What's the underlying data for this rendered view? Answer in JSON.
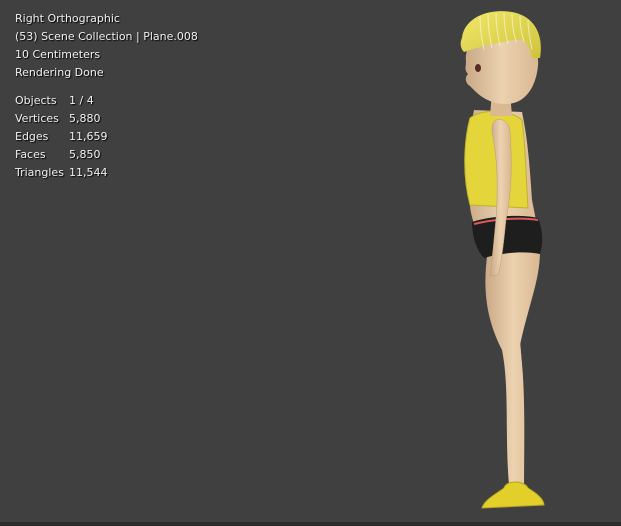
{
  "viewport": {
    "view_name": "Right Orthographic",
    "collection_info": "(53) Scene Collection | Plane.008",
    "grid_scale": "10 Centimeters",
    "render_status": "Rendering Done"
  },
  "statistics": [
    {
      "label": "Objects",
      "value": "1 / 4"
    },
    {
      "label": "Vertices",
      "value": "5,880"
    },
    {
      "label": "Edges",
      "value": "11,659"
    },
    {
      "label": "Faces",
      "value": "5,850"
    },
    {
      "label": "Triangles",
      "value": "11,544"
    }
  ],
  "colors": {
    "background": "#404040",
    "skin": "#e8c9a3",
    "hair": "#e7dd5a",
    "top": "#e3d53a",
    "shorts": "#1e1e1e",
    "shoes": "#e3cf2a"
  }
}
